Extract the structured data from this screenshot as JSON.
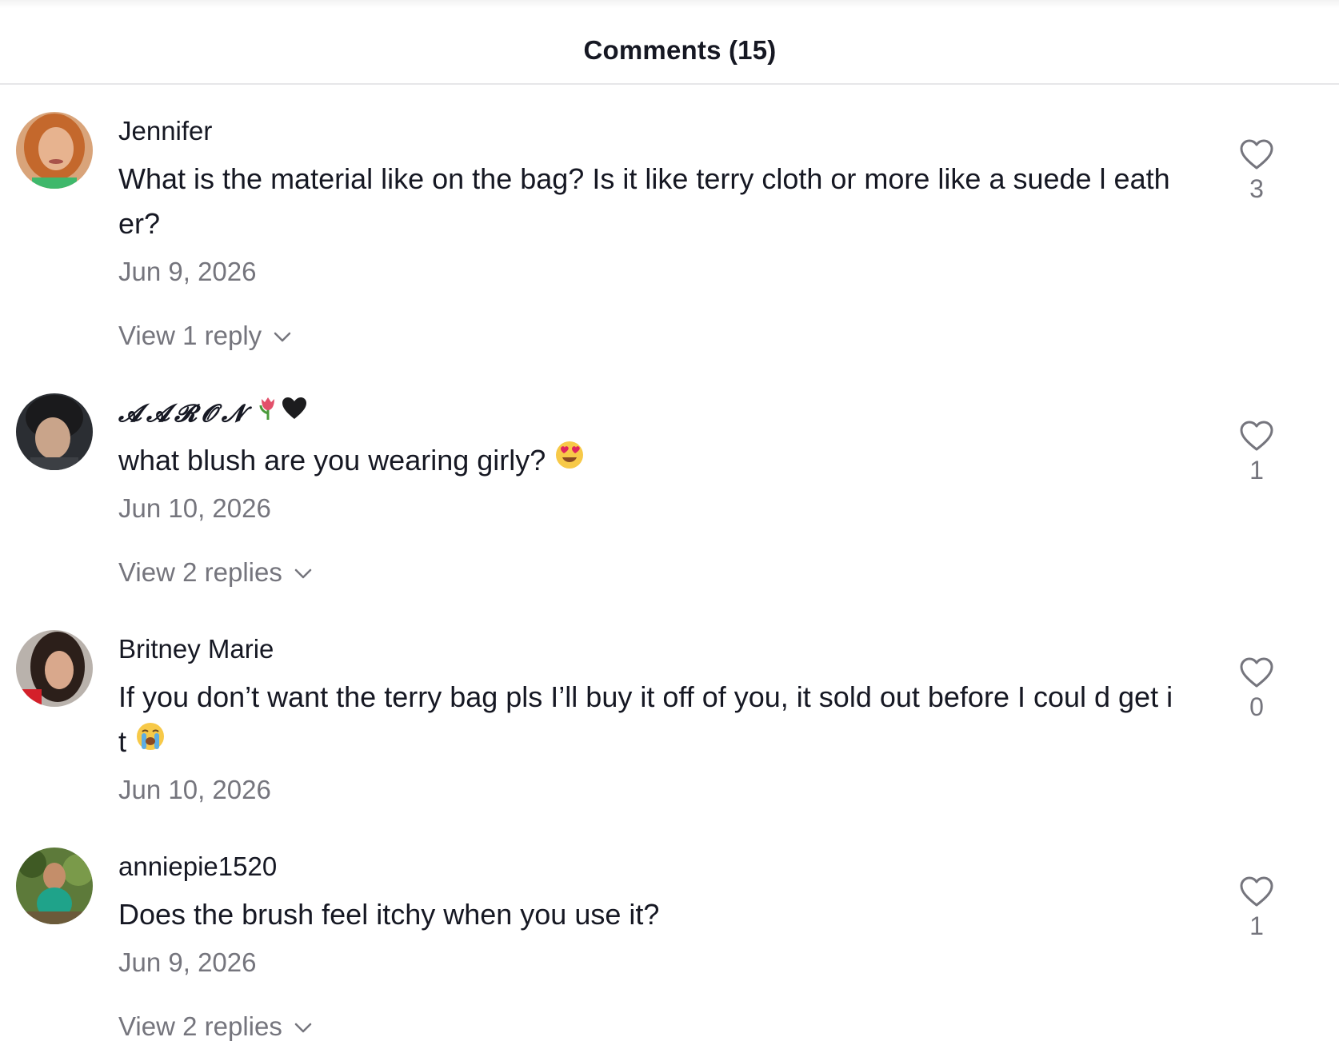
{
  "header": {
    "title": "Comments (15)"
  },
  "comments": [
    {
      "username": "Jennifer",
      "text": "What is the material like on the bag? Is it like terry cloth or more like a suede l eather?",
      "date": "Jun 9, 2026",
      "likes": "3",
      "replies_label": "View 1 reply",
      "avatar_icon": "avatar-photo"
    },
    {
      "username": "𝓐𝓐𝓡𝓞𝓝",
      "username_emojis": [
        "tulip-emoji",
        "black-heart-emoji"
      ],
      "text": "what blush are you wearing girly?",
      "text_emoji": "heart-eyes-emoji",
      "date": "Jun 10, 2026",
      "likes": "1",
      "replies_label": "View 2 replies",
      "avatar_icon": "avatar-photo"
    },
    {
      "username": "Britney Marie",
      "text": "If you don’t want the terry bag pls I’ll buy it off of you, it sold out before I coul d get it",
      "text_emoji": "loudly-crying-emoji",
      "date": "Jun 10, 2026",
      "likes": "0",
      "avatar_icon": "avatar-photo"
    },
    {
      "username": "anniepie1520",
      "text": "Does the brush feel itchy when you use it?",
      "date": "Jun 9, 2026",
      "likes": "1",
      "replies_label": "View 2 replies",
      "avatar_icon": "avatar-photo"
    }
  ],
  "colors": {
    "primary_text": "#161823",
    "secondary_text": "#75757d",
    "divider": "#e6e6e9",
    "background": "#ffffff"
  }
}
